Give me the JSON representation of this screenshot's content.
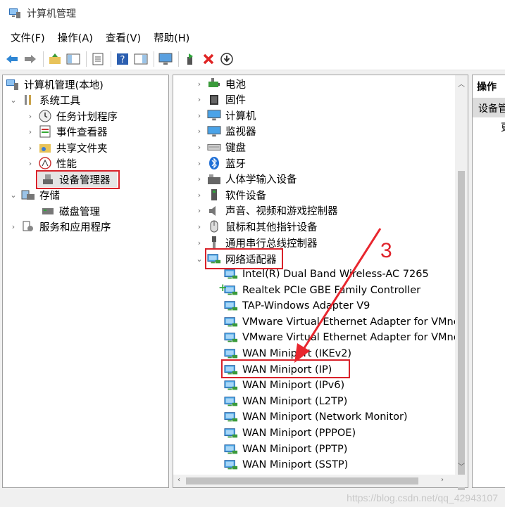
{
  "window": {
    "title": "计算机管理"
  },
  "menu": [
    "文件(F)",
    "操作(A)",
    "查看(V)",
    "帮助(H)"
  ],
  "toolbar": {
    "buttons": [
      "back-icon",
      "forward-icon",
      "up-folder-icon",
      "show-hide-tree-icon",
      "properties-icon",
      "help-icon",
      "show-action-pane-icon",
      "monitor-icon",
      "enable-device-icon",
      "uninstall-icon",
      "update-driver-icon"
    ]
  },
  "left_tree": {
    "root": "计算机管理(本地)",
    "system_tools": "系统工具",
    "task_scheduler": "任务计划程序",
    "event_viewer": "事件查看器",
    "shared_folders": "共享文件夹",
    "performance": "性能",
    "device_manager": "设备管理器",
    "storage": "存储",
    "disk_management": "磁盘管理",
    "services_apps": "服务和应用程序"
  },
  "device_tree": {
    "categories": [
      "电池",
      "固件",
      "计算机",
      "监视器",
      "键盘",
      "蓝牙",
      "人体学输入设备",
      "软件设备",
      "声音、视频和游戏控制器",
      "鼠标和其他指针设备",
      "通用串行总线控制器"
    ],
    "network_adapters": "网络适配器",
    "adapters": [
      "Intel(R) Dual Band Wireless-AC 7265",
      "Realtek PCIe GBE Family Controller",
      "TAP-Windows Adapter V9",
      "VMware Virtual Ethernet Adapter for VMnet",
      "VMware Virtual Ethernet Adapter for VMnet",
      "WAN Miniport (IKEv2)",
      "WAN Miniport (IP)",
      "WAN Miniport (IPv6)",
      "WAN Miniport (L2TP)",
      "WAN Miniport (Network Monitor)",
      "WAN Miniport (PPPOE)",
      "WAN Miniport (PPTP)",
      "WAN Miniport (SSTP)"
    ]
  },
  "actions_panel": {
    "header": "操作",
    "selected": "设备管",
    "sub": "更"
  },
  "annotation": {
    "number": "3"
  },
  "watermark": "https://blog.csdn.net/qq_42943107",
  "colors": {
    "highlight": "#d9222a",
    "arrow": "#e8262e"
  }
}
